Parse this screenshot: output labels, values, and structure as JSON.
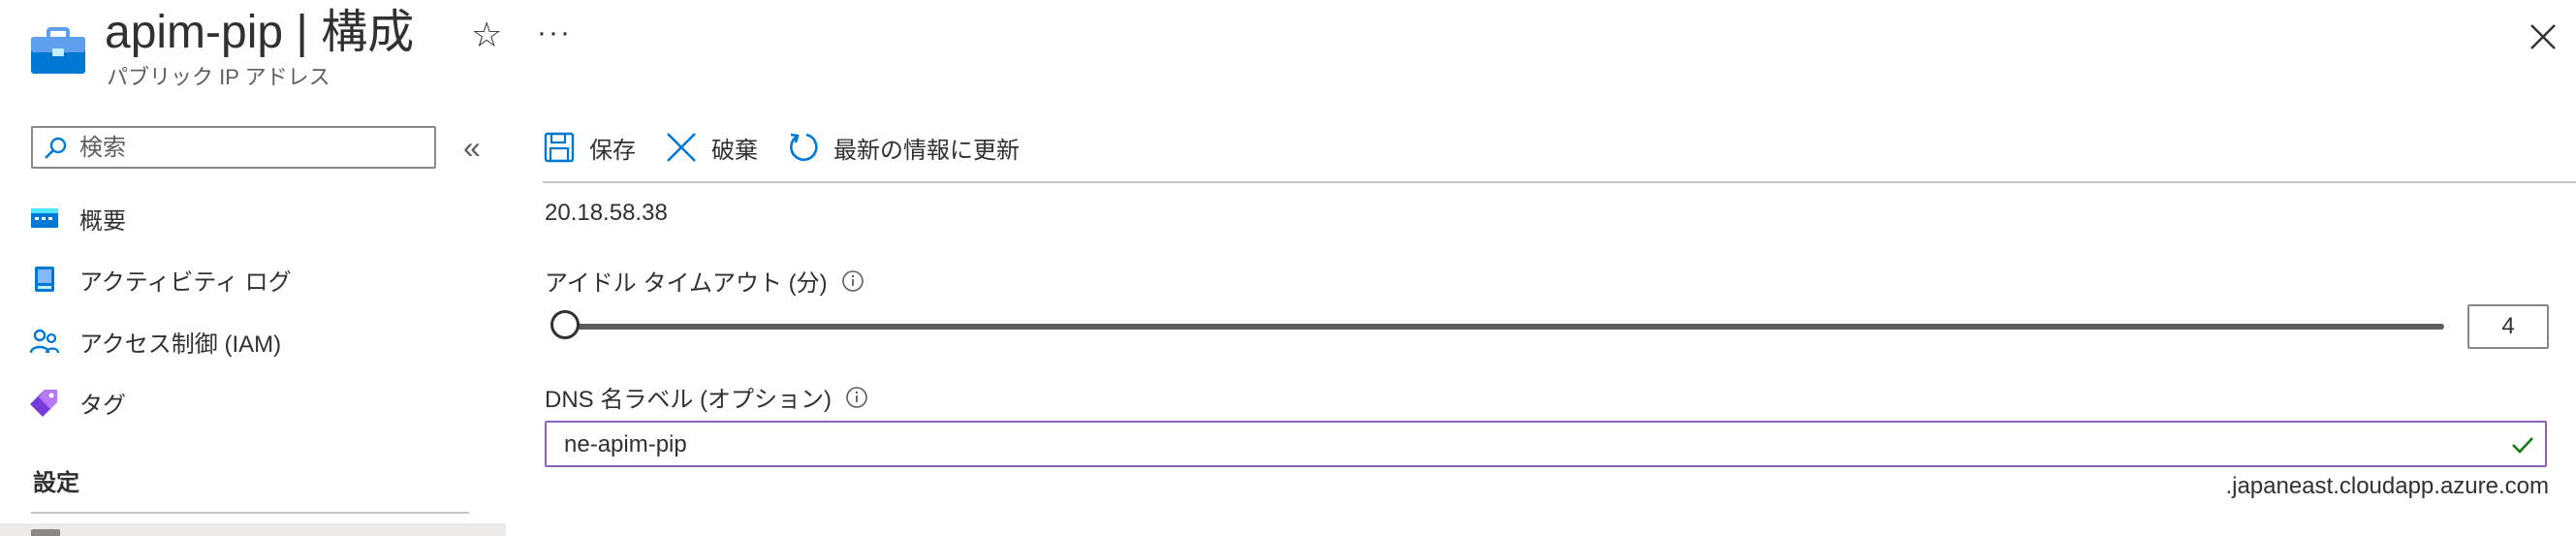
{
  "header": {
    "title": "apim-pip | 構成",
    "subtitle": "パブリック IP アドレス",
    "favorite_symbol": "☆",
    "more_symbol": "···",
    "resource_icon": "public-ip-briefcase-icon",
    "close_icon": "close-icon"
  },
  "sidebar": {
    "search_placeholder": "検索",
    "collapse_symbol": "«",
    "items": [
      {
        "label": "概要",
        "icon": "overview-icon"
      },
      {
        "label": "アクティビティ ログ",
        "icon": "activity-log-icon"
      },
      {
        "label": "アクセス制御 (IAM)",
        "icon": "iam-users-icon"
      },
      {
        "label": "タグ",
        "icon": "tag-icon"
      }
    ],
    "section_settings": "設定"
  },
  "toolbar": {
    "save_label": "保存",
    "discard_label": "破棄",
    "refresh_label": "最新の情報に更新"
  },
  "form": {
    "ip_address_value": "20.18.58.38",
    "idle_timeout_label": "アイドル タイムアウト (分)",
    "idle_timeout_value": "4",
    "idle_timeout_fraction": 0,
    "dns_label": "DNS 名ラベル (オプション)",
    "dns_value": "ne-apim-pip",
    "dns_suffix": ".japaneast.cloudapp.azure.com"
  },
  "colors": {
    "accent": "#0078d4",
    "dns_border": "#8764b8",
    "valid_check": "#107c10",
    "text": "#323130"
  }
}
